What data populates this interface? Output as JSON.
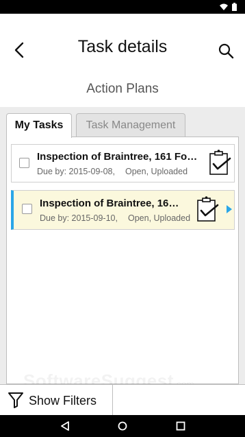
{
  "header": {
    "title": "Task details",
    "subtitle": "Action Plans"
  },
  "tabs": [
    {
      "label": "My Tasks",
      "active": true
    },
    {
      "label": "Task Management",
      "active": false
    }
  ],
  "tasks": [
    {
      "name": "Inspection of Braintree, 161 Fo…",
      "due": "Due by: 2015-09-08,",
      "status": "Open, Uploaded",
      "selected": false
    },
    {
      "name": "Inspection of Braintree, 16…",
      "due": "Due by: 2015-09-10,",
      "status": "Open, Uploaded",
      "selected": true
    }
  ],
  "footer": {
    "filter_label": "Show Filters"
  },
  "watermark": {
    "text": "SoftwareSuggest",
    "suffix": ".com"
  },
  "colors": {
    "selected_accent": "#2aa6e8",
    "selected_background": "#fbf8dd",
    "content_background": "#ececec"
  },
  "icons": [
    "back-arrow-icon",
    "search-icon",
    "clipboard-check-icon",
    "chevron-right-icon",
    "filter-funnel-icon",
    "wifi-icon",
    "battery-icon",
    "nav-back-icon",
    "nav-home-icon",
    "nav-recents-icon"
  ]
}
